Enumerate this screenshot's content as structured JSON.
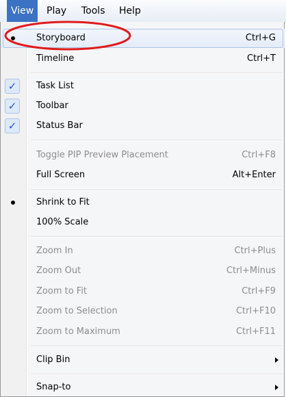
{
  "menubar": {
    "items": [
      {
        "label": "View",
        "active": true
      },
      {
        "label": "Play"
      },
      {
        "label": "Tools"
      },
      {
        "label": "Help"
      }
    ]
  },
  "menu": {
    "storyboard": {
      "label": "Storyboard",
      "shortcut": "Ctrl+G",
      "mark": "bullet"
    },
    "timeline": {
      "label": "Timeline",
      "shortcut": "Ctrl+T"
    },
    "task_list": {
      "label": "Task List",
      "checked": true
    },
    "toolbar": {
      "label": "Toolbar",
      "checked": true
    },
    "status_bar": {
      "label": "Status Bar",
      "checked": true
    },
    "toggle_pip": {
      "label": "Toggle PIP Preview Placement",
      "shortcut": "Ctrl+F8",
      "enabled": false
    },
    "full_screen": {
      "label": "Full Screen",
      "shortcut": "Alt+Enter"
    },
    "shrink_to_fit": {
      "label": "Shrink to Fit",
      "mark": "bullet"
    },
    "scale_100": {
      "label": "100% Scale"
    },
    "zoom_in": {
      "label": "Zoom In",
      "shortcut": "Ctrl+Plus",
      "enabled": false
    },
    "zoom_out": {
      "label": "Zoom Out",
      "shortcut": "Ctrl+Minus",
      "enabled": false
    },
    "zoom_to_fit": {
      "label": "Zoom to Fit",
      "shortcut": "Ctrl+F9",
      "enabled": false
    },
    "zoom_to_selection": {
      "label": "Zoom to Selection",
      "shortcut": "Ctrl+F10",
      "enabled": false
    },
    "zoom_to_maximum": {
      "label": "Zoom to Maximum",
      "shortcut": "Ctrl+F11",
      "enabled": false
    },
    "clip_bin": {
      "label": "Clip Bin",
      "submenu": true
    },
    "snap_to": {
      "label": "Snap-to",
      "submenu": true
    }
  },
  "annotation": {
    "color": "#e01b1b",
    "shape": "ellipse",
    "target": "Storyboard"
  },
  "colors": {
    "menu_active_bg": "#3b72c4",
    "check_color": "#1e56c4",
    "disabled_text": "#8d8d8d"
  }
}
